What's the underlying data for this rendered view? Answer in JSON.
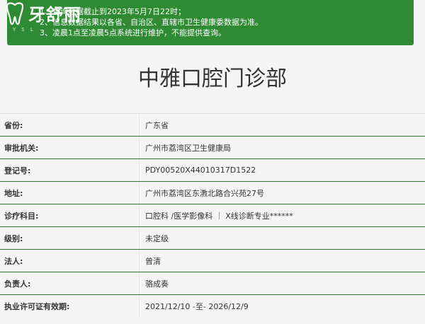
{
  "notice": {
    "lines": [
      "1、查询数据截止到2023年5月7日22时；",
      "2、信息数据结果以各省、自治区、直辖市卫生健康委数据为准。",
      "3、凌晨1点至凌晨5点系统进行维护，不能提供查询。"
    ],
    "watermark_text": "牙舒丽",
    "watermark_sub": "Y S L"
  },
  "title": "中雅口腔门诊部",
  "rows": [
    {
      "label": "省份:",
      "value": "广东省"
    },
    {
      "label": "审批机关:",
      "value": "广州市荔湾区卫生健康局"
    },
    {
      "label": "登记号:",
      "value": "PDY00520X44010317D1522"
    },
    {
      "label": "地址:",
      "value": "广州市荔湾区东漖北路合兴苑27号"
    },
    {
      "label": "诊疗科目:",
      "value": "口腔科 /医学影像科 ｜ X线诊断专业******"
    },
    {
      "label": "级别:",
      "value": "未定级"
    },
    {
      "label": "法人:",
      "value": "曾清"
    },
    {
      "label": "负责人:",
      "value": "骆成奏"
    },
    {
      "label": "执业许可证有效期:",
      "value": "2021/12/10 -至- 2026/12/9"
    }
  ],
  "colors": {
    "notice_bg": "#2f8a34",
    "row_border": "#2a7a35"
  }
}
